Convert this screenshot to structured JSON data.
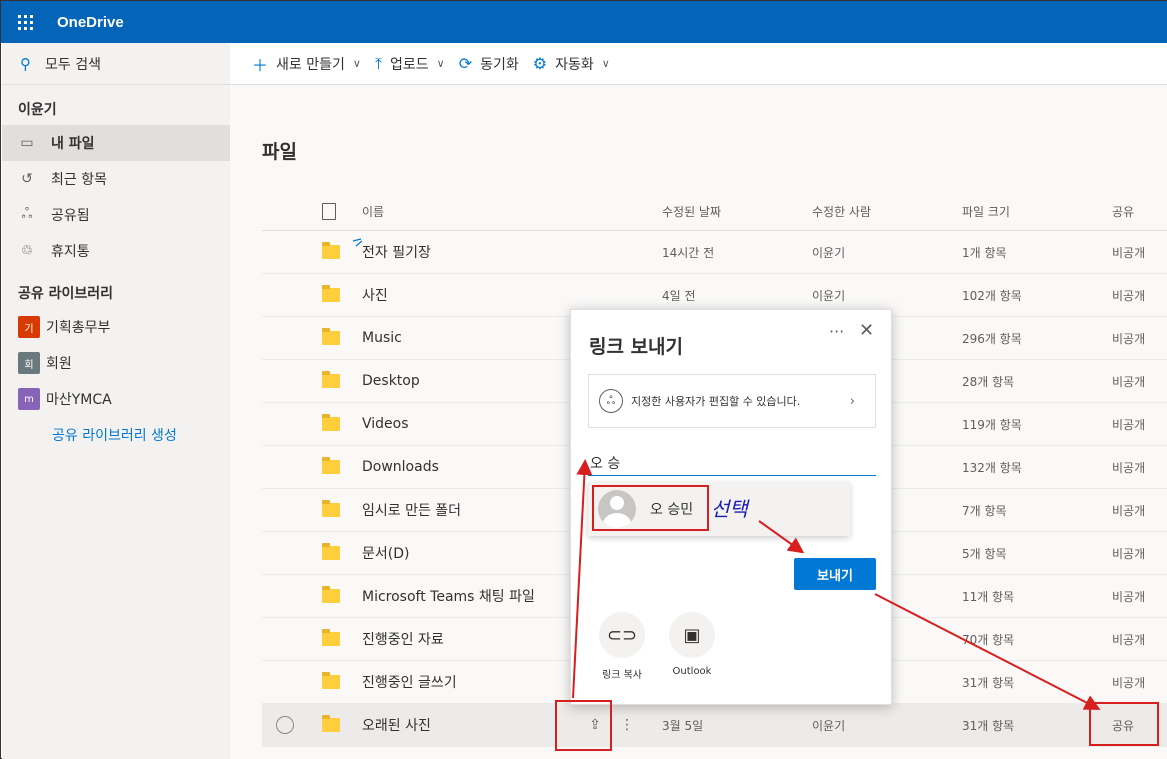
{
  "app": {
    "title": "OneDrive"
  },
  "sidebar": {
    "search_label": "모두 검색",
    "user_name": "이윤기",
    "nav_items": [
      {
        "label": "내 파일",
        "icon": "folder-icon"
      },
      {
        "label": "최근 항목",
        "icon": "history-icon"
      },
      {
        "label": "공유됨",
        "icon": "people-icon"
      },
      {
        "label": "휴지통",
        "icon": "recycle-bin-icon"
      }
    ],
    "libraries_title": "공유 라이브러리",
    "libraries": [
      {
        "badge": "기",
        "label": "기획총무부",
        "color": "#d83b01"
      },
      {
        "badge": "회",
        "label": "회원",
        "color": "#69797e"
      },
      {
        "badge": "m",
        "label": "마산YMCA",
        "color": "#8764b8"
      }
    ],
    "create_library": "공유 라이브러리 생성"
  },
  "toolbar": {
    "new_label": "새로 만들기",
    "upload_label": "업로드",
    "sync_label": "동기화",
    "automate_label": "자동화"
  },
  "main": {
    "title": "파일",
    "columns": {
      "name": "이름",
      "modified": "수정된 날짜",
      "modified_by": "수정한 사람",
      "size": "파일 크기",
      "sharing": "공유"
    },
    "rows": [
      {
        "name": "전자 필기장",
        "modified": "14시간 전",
        "modified_by": "이윤기",
        "size": "1개 항목",
        "sharing": "비공개"
      },
      {
        "name": "사진",
        "modified": "4일 전",
        "modified_by": "이윤기",
        "size": "102개 항목",
        "sharing": "비공개"
      },
      {
        "name": "Music",
        "modified": "",
        "modified_by": "",
        "size": "296개 항목",
        "sharing": "비공개"
      },
      {
        "name": "Desktop",
        "modified": "",
        "modified_by": "",
        "size": "28개 항목",
        "sharing": "비공개"
      },
      {
        "name": "Videos",
        "modified": "",
        "modified_by": "",
        "size": "119개 항목",
        "sharing": "비공개"
      },
      {
        "name": "Downloads",
        "modified": "",
        "modified_by": "",
        "size": "132개 항목",
        "sharing": "비공개"
      },
      {
        "name": "임시로 만든 폴더",
        "modified": "",
        "modified_by": "",
        "size": "7개 항목",
        "sharing": "비공개"
      },
      {
        "name": "문서(D)",
        "modified": "",
        "modified_by": "",
        "size": "5개 항목",
        "sharing": "비공개"
      },
      {
        "name": "Microsoft Teams 채팅 파일",
        "modified": "",
        "modified_by": "",
        "size": "11개 항목",
        "sharing": "비공개"
      },
      {
        "name": "진행중인 자료",
        "modified": "",
        "modified_by": "",
        "size": "70개 항목",
        "sharing": "비공개"
      },
      {
        "name": "진행중인 글쓰기",
        "modified": "",
        "modified_by": "",
        "size": "31개 항목",
        "sharing": "비공개"
      },
      {
        "name": "오래된 사진",
        "modified": "3월 5일",
        "modified_by": "이윤기",
        "size": "31개 항목",
        "sharing": "공유"
      }
    ]
  },
  "dialog": {
    "title": "링크 보내기",
    "permission_text": "지정한 사용자가 편집할 수 있습니다.",
    "to_value": "오 승",
    "suggestion_name": "오 승민",
    "send_label": "보내기",
    "copy_link_label": "링크 복사",
    "outlook_label": "Outlook"
  },
  "annotation": {
    "select_text": "선택"
  }
}
